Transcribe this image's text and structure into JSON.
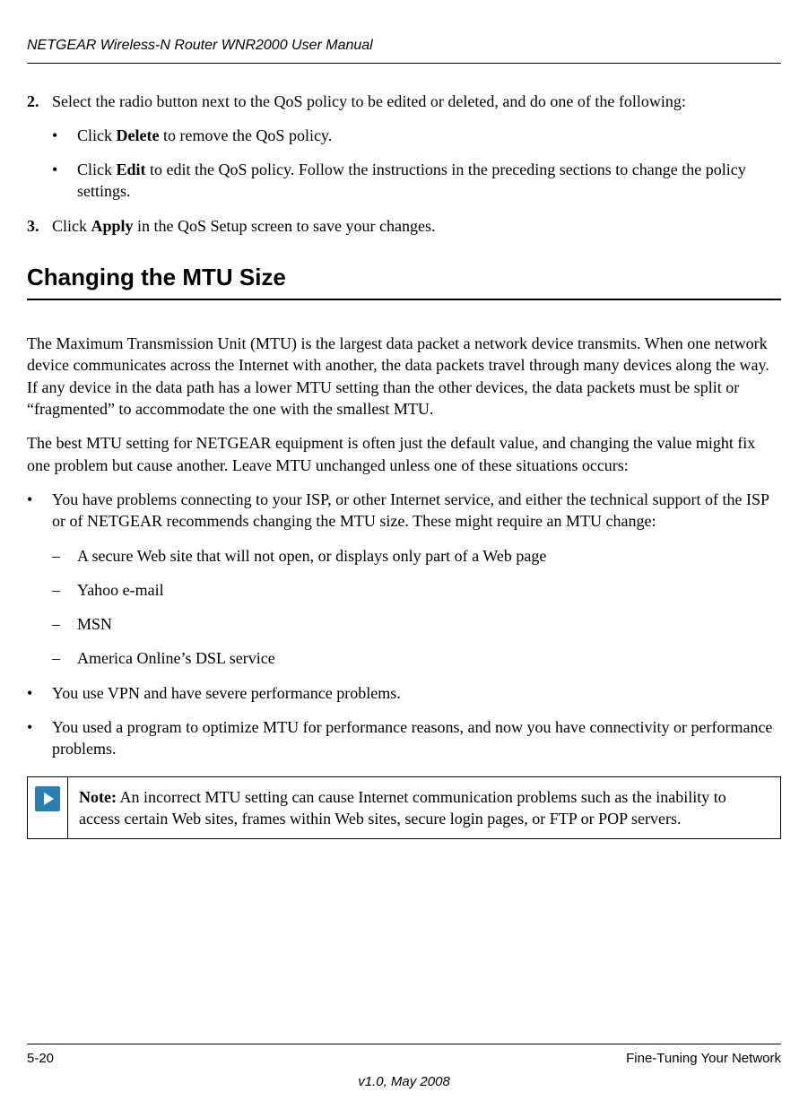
{
  "header": {
    "title": "NETGEAR Wireless-N Router WNR2000 User Manual"
  },
  "step2": {
    "num": "2.",
    "text_before": "Select the radio button next to the QoS policy to be edited or deleted, and do one of the following:",
    "b1_prefix": "Click ",
    "b1_bold": "Delete",
    "b1_suffix": " to remove the QoS policy.",
    "b2_prefix": "Click ",
    "b2_bold": "Edit",
    "b2_suffix": " to edit the QoS policy. Follow the instructions in the preceding sections to change the policy settings."
  },
  "step3": {
    "num": "3.",
    "prefix": "Click ",
    "bold": "Apply",
    "suffix": " in the QoS Setup screen to save your changes."
  },
  "heading": "Changing the MTU Size",
  "para1": "The Maximum Transmission Unit (MTU) is the largest data packet a network device transmits. When one network device communicates across the Internet with another, the data packets travel through many devices along the way. If any device in the data path has a lower MTU setting than the other devices, the data packets must be split or “fragmented” to accommodate the one with the smallest MTU.",
  "para2": "The best MTU setting for NETGEAR equipment is often just the default value, and changing the value might fix one problem but cause another. Leave MTU unchanged unless one of these situations occurs:",
  "bullets": {
    "b1": "You have problems connecting to your ISP, or other Internet service, and either the technical support of the ISP or of NETGEAR recommends changing the MTU size. These might require an MTU change:",
    "d1": "A secure Web site that will not open, or displays only part of a Web page",
    "d2": "Yahoo e-mail",
    "d3": "MSN",
    "d4": "America Online’s DSL service",
    "b2": "You use VPN and have severe performance problems.",
    "b3": "You used a program to optimize MTU for performance reasons, and now you have connectivity or performance problems."
  },
  "note": {
    "label": "Note:",
    "text": " An incorrect MTU setting can cause Internet communication problems such as the inability to access certain Web sites, frames within Web sites, secure login pages, or FTP or POP servers."
  },
  "footer": {
    "page": "5-20",
    "section": "Fine-Tuning Your Network",
    "version": "v1.0, May 2008"
  },
  "marks": {
    "bullet": "•",
    "dash": "–"
  }
}
